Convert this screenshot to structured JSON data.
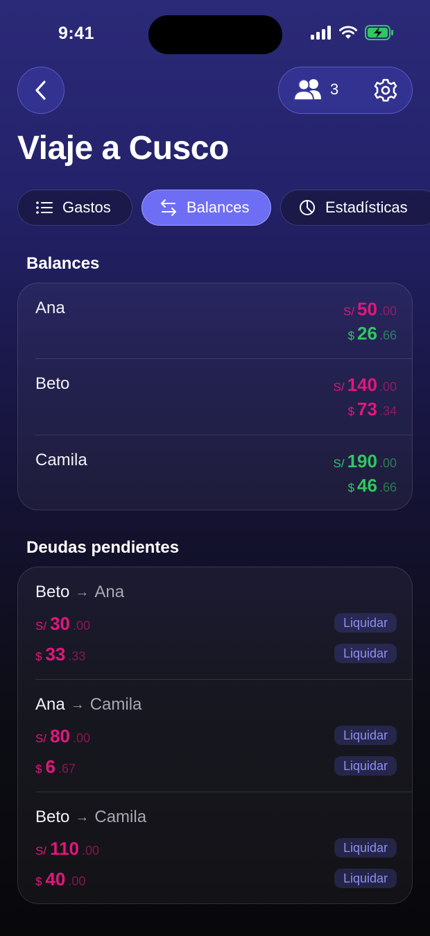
{
  "status_bar": {
    "time": "9:41"
  },
  "header": {
    "members_count": "3",
    "title": "Viaje a Cusco"
  },
  "tabs": [
    {
      "label": "Gastos",
      "icon": "list-icon",
      "active": false
    },
    {
      "label": "Balances",
      "icon": "swap-arrows-icon",
      "active": true
    },
    {
      "label": "Estadísticas",
      "icon": "pie-chart-icon",
      "active": false
    }
  ],
  "balances": {
    "section_title": "Balances",
    "rows": [
      {
        "name": "Ana",
        "pen": {
          "currency": "S/",
          "int": "50",
          "dec": ".00",
          "tone": "neg"
        },
        "usd": {
          "currency": "$",
          "int": "26",
          "dec": ".66",
          "tone": "pos"
        }
      },
      {
        "name": "Beto",
        "pen": {
          "currency": "S/",
          "int": "140",
          "dec": ".00",
          "tone": "neg"
        },
        "usd": {
          "currency": "$",
          "int": "73",
          "dec": ".34",
          "tone": "neg"
        }
      },
      {
        "name": "Camila",
        "pen": {
          "currency": "S/",
          "int": "190",
          "dec": ".00",
          "tone": "pos"
        },
        "usd": {
          "currency": "$",
          "int": "46",
          "dec": ".66",
          "tone": "pos"
        }
      }
    ]
  },
  "debts": {
    "section_title": "Deudas pendientes",
    "settle_label": "Liquidar",
    "arrow": "→",
    "items": [
      {
        "from": "Beto",
        "to": "Ana",
        "pen": {
          "currency": "S/",
          "int": "30",
          "dec": ".00"
        },
        "usd": {
          "currency": "$",
          "int": "33",
          "dec": ".33"
        }
      },
      {
        "from": "Ana",
        "to": "Camila",
        "pen": {
          "currency": "S/",
          "int": "80",
          "dec": ".00"
        },
        "usd": {
          "currency": "$",
          "int": "6",
          "dec": ".67"
        }
      },
      {
        "from": "Beto",
        "to": "Camila",
        "pen": {
          "currency": "S/",
          "int": "110",
          "dec": ".00"
        },
        "usd": {
          "currency": "$",
          "int": "40",
          "dec": ".00"
        }
      }
    ]
  },
  "colors": {
    "negative": "#e0187a",
    "positive": "#2fc760",
    "accent": "#6e6ef5"
  }
}
